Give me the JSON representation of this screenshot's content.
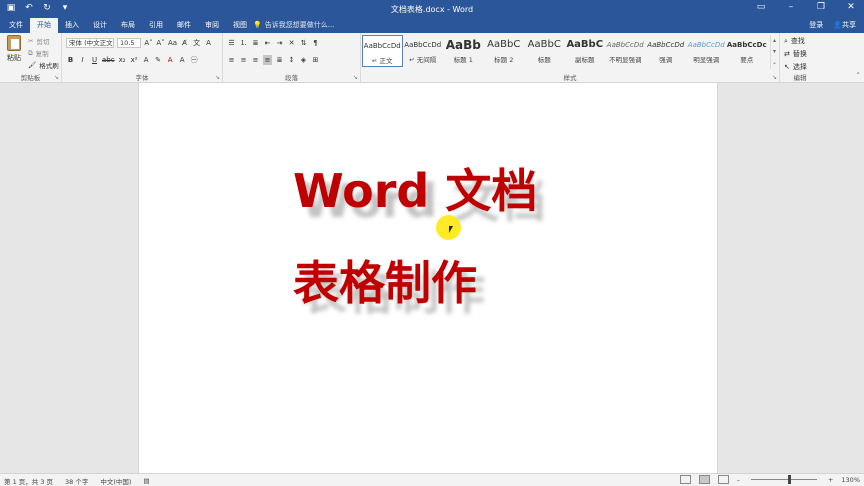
{
  "titlebar": {
    "doc_title": "文档表格.docx - Word",
    "save_icon": "save-icon",
    "undo_icon": "undo-icon",
    "redo_icon": "redo-icon"
  },
  "tabs": [
    {
      "label": "文件"
    },
    {
      "label": "开始"
    },
    {
      "label": "插入"
    },
    {
      "label": "设计"
    },
    {
      "label": "布局"
    },
    {
      "label": "引用"
    },
    {
      "label": "邮件"
    },
    {
      "label": "审阅"
    },
    {
      "label": "视图"
    }
  ],
  "tellme": {
    "placeholder": "告诉我您想要做什么..."
  },
  "account": {
    "login": "登录",
    "share": "共享"
  },
  "clipboard": {
    "paste": "粘贴",
    "cut": "剪切",
    "copy": "复制",
    "format_painter": "格式刷",
    "group": "剪贴板"
  },
  "font": {
    "name": "宋体 (中文正文)",
    "size": "10.5",
    "group": "字体"
  },
  "paragraph": {
    "group": "段落"
  },
  "styles": {
    "group": "样式",
    "items": [
      {
        "preview": "AaBbCcDd",
        "name": "↵ 正文"
      },
      {
        "preview": "AaBbCcDd",
        "name": "↵ 无间隔"
      },
      {
        "preview": "AaBb",
        "name": "标题 1"
      },
      {
        "preview": "AaBbC",
        "name": "标题 2"
      },
      {
        "preview": "AaBbC",
        "name": "标题"
      },
      {
        "preview": "AaBbC",
        "name": "副标题"
      },
      {
        "preview": "AaBbCcDd",
        "name": "不明显强调"
      },
      {
        "preview": "AaBbCcDd",
        "name": "强调"
      },
      {
        "preview": "AaBbCcDd",
        "name": "明显强调"
      },
      {
        "preview": "AaBbCcDc",
        "name": "要点"
      }
    ]
  },
  "editing": {
    "find": "查找",
    "replace": "替换",
    "select": "选择",
    "group": "编辑"
  },
  "document": {
    "line1": "Word 文档",
    "line2": "表格制作"
  },
  "status": {
    "page": "第 1 页，共 3 页",
    "words": "38 个字",
    "language": "中文(中国)",
    "zoom": "130%"
  },
  "colors": {
    "brand": "#2b579a",
    "heading": "#c00000"
  }
}
